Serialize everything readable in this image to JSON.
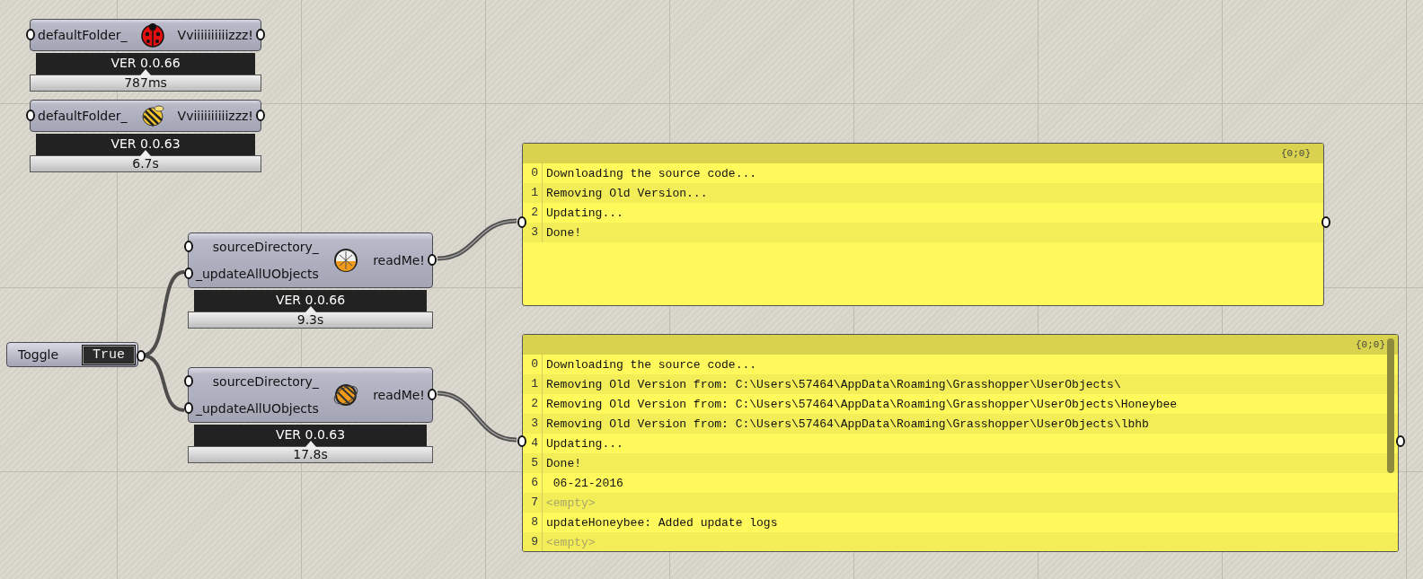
{
  "components": [
    {
      "inputs": [
        "defaultFolder_"
      ],
      "outputs": [
        "Vviiiiiiiiiizzz!"
      ],
      "version": "VER 0.0.66",
      "time": "787ms"
    },
    {
      "inputs": [
        "defaultFolder_"
      ],
      "outputs": [
        "Vviiiiiiiiiizzz!"
      ],
      "version": "VER 0.0.63",
      "time": "6.7s"
    },
    {
      "inputs": [
        "sourceDirectory_",
        "_updateAllUObjects"
      ],
      "outputs": [
        "readMe!"
      ],
      "version": "VER 0.0.66",
      "time": "9.3s"
    },
    {
      "inputs": [
        "sourceDirectory_",
        "_updateAllUObjects"
      ],
      "outputs": [
        "readMe!"
      ],
      "version": "VER 0.0.63",
      "time": "17.8s"
    }
  ],
  "toggle": {
    "label": "Toggle",
    "value": "True"
  },
  "panels": [
    {
      "path": "{0;0}",
      "scrollbar": false,
      "rows": [
        {
          "index": "0",
          "kind": "text",
          "text": "Downloading the source code..."
        },
        {
          "index": "1",
          "kind": "text",
          "text": "Removing Old Version..."
        },
        {
          "index": "2",
          "kind": "text",
          "text": "Updating..."
        },
        {
          "index": "3",
          "kind": "text",
          "text": "Done!"
        }
      ]
    },
    {
      "path": "{0;0}",
      "scrollbar": true,
      "rows": [
        {
          "index": "0",
          "kind": "text",
          "text": "Downloading the source code..."
        },
        {
          "index": "1",
          "kind": "text",
          "text": "Removing Old Version from: C:\\Users\\57464\\AppData\\Roaming\\Grasshopper\\UserObjects\\"
        },
        {
          "index": "2",
          "kind": "text",
          "text": "Removing Old Version from: C:\\Users\\57464\\AppData\\Roaming\\Grasshopper\\UserObjects\\Honeybee"
        },
        {
          "index": "3",
          "kind": "text",
          "text": "Removing Old Version from: C:\\Users\\57464\\AppData\\Roaming\\Grasshopper\\UserObjects\\lbhb"
        },
        {
          "index": "4",
          "kind": "text",
          "text": "Updating..."
        },
        {
          "index": "5",
          "kind": "text",
          "text": "Done!"
        },
        {
          "index": "6",
          "kind": "text",
          "text": " 06-21-2016"
        },
        {
          "index": "7",
          "kind": "empty",
          "text": "<empty>"
        },
        {
          "index": "8",
          "kind": "text",
          "text": "updateHoneybee: Added update logs"
        },
        {
          "index": "9",
          "kind": "empty",
          "text": "<empty>"
        }
      ]
    }
  ]
}
